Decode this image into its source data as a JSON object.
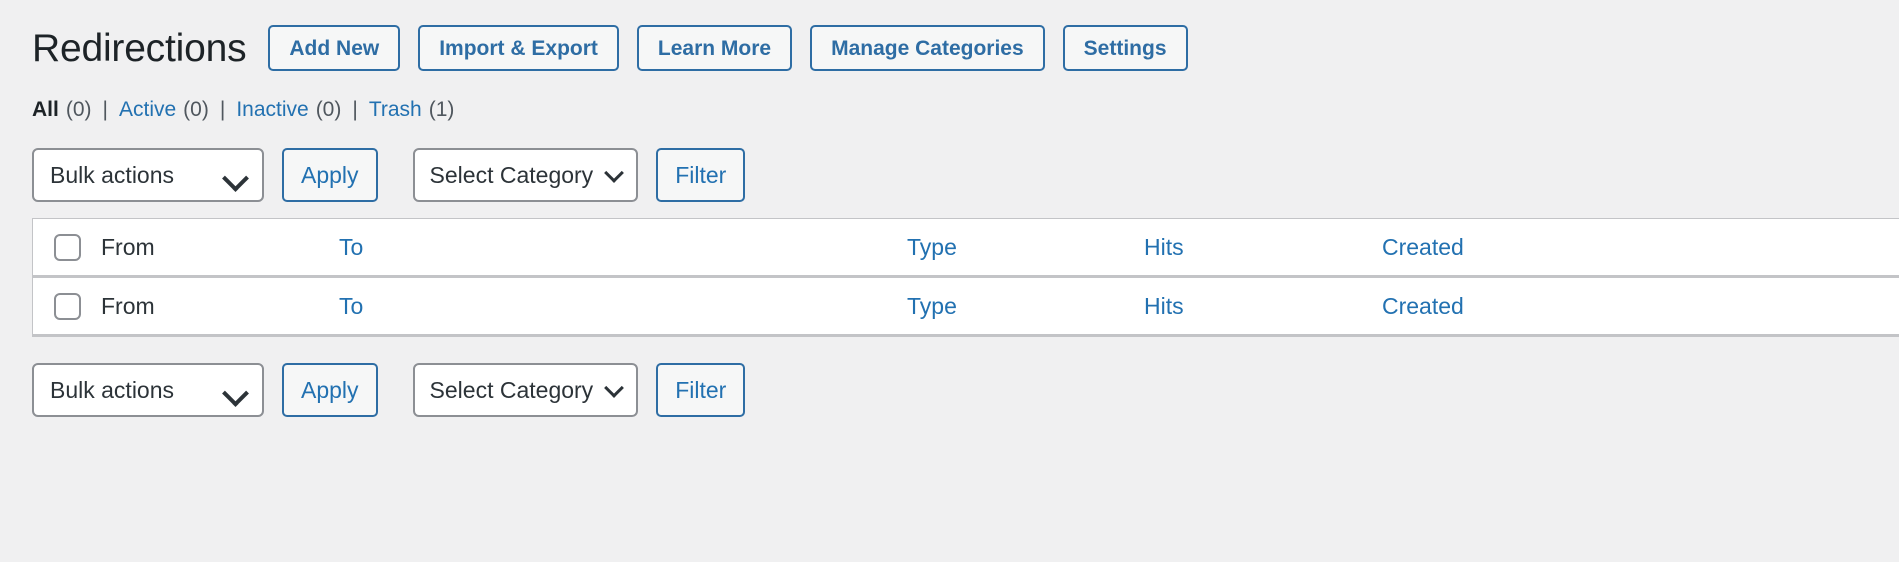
{
  "header": {
    "title": "Redirections",
    "buttons": [
      {
        "label": "Add New",
        "name": "add-new-button"
      },
      {
        "label": "Import & Export",
        "name": "import-export-button"
      },
      {
        "label": "Learn More",
        "name": "learn-more-button"
      },
      {
        "label": "Manage Categories",
        "name": "manage-categories-button"
      },
      {
        "label": "Settings",
        "name": "settings-button"
      }
    ]
  },
  "filter_links": [
    {
      "label": "All",
      "count": "(0)",
      "current": true
    },
    {
      "label": "Active",
      "count": "(0)",
      "current": false
    },
    {
      "label": "Inactive",
      "count": "(0)",
      "current": false
    },
    {
      "label": "Trash",
      "count": "(1)",
      "current": false
    }
  ],
  "separator": "|",
  "tablenav": {
    "bulk_actions_label": "Bulk actions",
    "apply_label": "Apply",
    "select_category_label": "Select Category",
    "filter_label": "Filter"
  },
  "table": {
    "columns": {
      "from": "From",
      "to": "To",
      "type": "Type",
      "hits": "Hits",
      "created": "Created"
    }
  },
  "colors": {
    "page_background": "#f0f0f1",
    "link_blue": "#2271b1",
    "button_border_blue": "#2e6da4",
    "text_dark": "#1d2327",
    "text_muted": "#50575e",
    "border_gray": "#c3c4c7",
    "control_border": "#8c8f94"
  }
}
